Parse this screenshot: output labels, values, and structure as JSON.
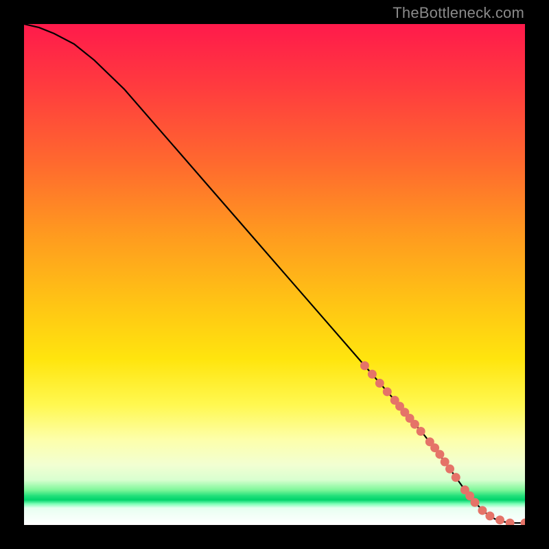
{
  "watermark": "TheBottleneck.com",
  "colors": {
    "background": "#000000",
    "curve_stroke": "#000000",
    "marker_fill": "#e57368",
    "gradient_top": "#ff1a4b",
    "gradient_mid": "#ffe50e",
    "gradient_band": "#00d46b",
    "gradient_bottom": "#ffffff"
  },
  "chart_data": {
    "type": "line",
    "title": "",
    "xlabel": "",
    "ylabel": "",
    "xlim": [
      0,
      100
    ],
    "ylim": [
      0,
      100
    ],
    "grid": false,
    "legend": false,
    "curve": {
      "comment": "Main black curve; x/y in 0-100 plot coords (origin lower-left).",
      "x": [
        0,
        3,
        6,
        10,
        14,
        20,
        28,
        36,
        44,
        52,
        60,
        68,
        74,
        80,
        84,
        86,
        88,
        90,
        92,
        94,
        96,
        98,
        100
      ],
      "y": [
        100,
        99.3,
        98.1,
        96.0,
        92.8,
        87.0,
        77.8,
        68.6,
        59.4,
        50.2,
        41.0,
        31.8,
        24.9,
        17.8,
        12.6,
        9.8,
        7.0,
        4.5,
        2.5,
        1.2,
        0.6,
        0.4,
        0.4
      ]
    },
    "markers": {
      "comment": "Salmon dot markers placed along lower-right of curve and along the flat tail.",
      "x": [
        68,
        69.5,
        71,
        72.5,
        74,
        75,
        76,
        77,
        78,
        79.2,
        81,
        82,
        83,
        84,
        85,
        86.2,
        88,
        89,
        90,
        91.5,
        93,
        95,
        97,
        100
      ],
      "y": [
        31.8,
        30.1,
        28.3,
        26.6,
        24.9,
        23.7,
        22.5,
        21.3,
        20.1,
        18.7,
        16.6,
        15.4,
        14.1,
        12.6,
        11.2,
        9.5,
        7.0,
        5.8,
        4.5,
        2.9,
        1.8,
        1.0,
        0.4,
        0.4
      ]
    }
  }
}
